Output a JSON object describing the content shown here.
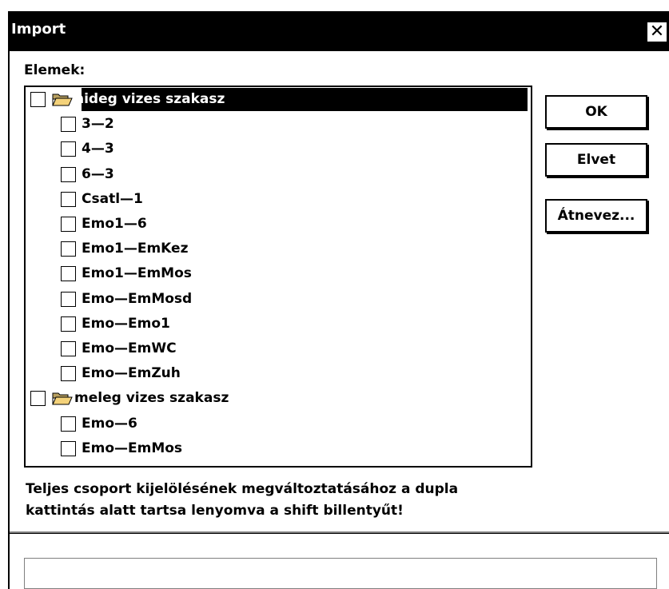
{
  "dialog": {
    "title": "Import",
    "close_glyph": "✕"
  },
  "list": {
    "label": "Elemek:",
    "items": [
      {
        "level": 0,
        "text": "hideg vizes szakasz",
        "checked": false,
        "folder": true,
        "selected": true
      },
      {
        "level": 1,
        "text": "3—2",
        "checked": false
      },
      {
        "level": 1,
        "text": "4—3",
        "checked": false
      },
      {
        "level": 1,
        "text": "6—3",
        "checked": false
      },
      {
        "level": 1,
        "text": "Csatl—1",
        "checked": false
      },
      {
        "level": 1,
        "text": "Emo1—6",
        "checked": false
      },
      {
        "level": 1,
        "text": "Emo1—EmKez",
        "checked": false
      },
      {
        "level": 1,
        "text": "Emo1—EmMos",
        "checked": false
      },
      {
        "level": 1,
        "text": "Emo—EmMosd",
        "checked": false
      },
      {
        "level": 1,
        "text": "Emo—Emo1",
        "checked": false
      },
      {
        "level": 1,
        "text": "Emo—EmWC",
        "checked": false
      },
      {
        "level": 1,
        "text": "Emo—EmZuh",
        "checked": false
      },
      {
        "level": 0,
        "text": "meleg vizes szakasz",
        "checked": false,
        "folder": true,
        "selected": false
      },
      {
        "level": 1,
        "text": "Emo—6",
        "checked": false
      },
      {
        "level": 1,
        "text": "Emo—EmMos",
        "checked": false
      }
    ]
  },
  "buttons": {
    "ok": "OK",
    "cancel": "Elvet",
    "rename": "Átnevez..."
  },
  "hint": {
    "line1": "Teljes csoport kijelölésének megváltoztatásához a dupla",
    "line2": "kattintás alatt tartsa lenyomva a shift billentyűt!"
  },
  "status": {
    "text": ""
  },
  "icons": {
    "folder": "folder-open-icon",
    "close": "close-icon"
  }
}
